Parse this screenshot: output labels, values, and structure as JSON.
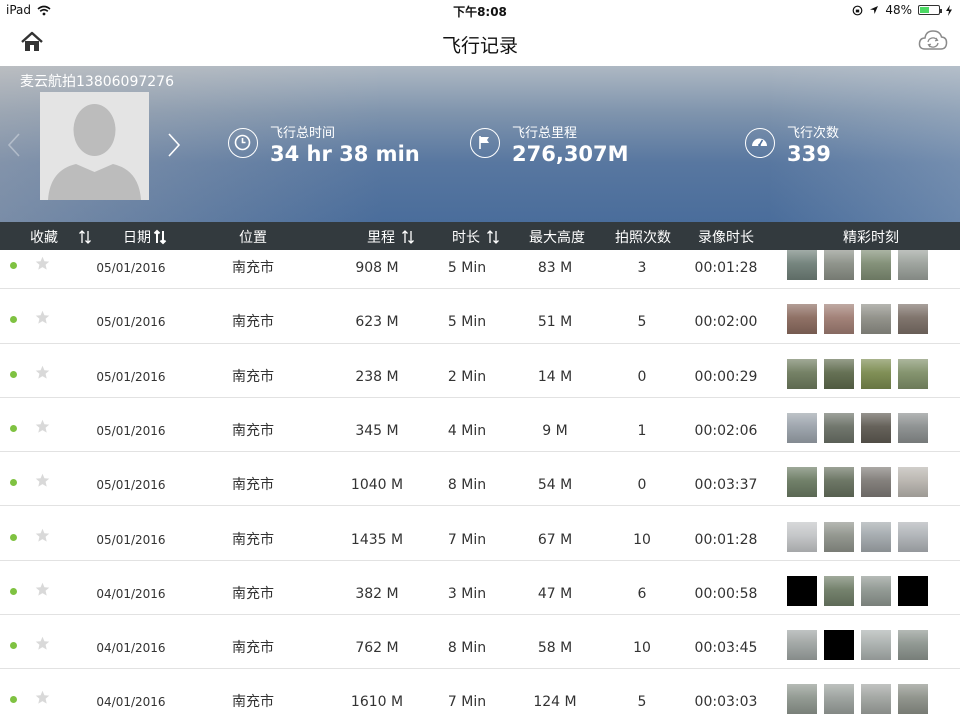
{
  "status_bar": {
    "device": "iPad",
    "time": "下午8:08",
    "battery": "48%",
    "battery_level": 0.48
  },
  "nav": {
    "title": "飞行记录",
    "home_icon": "home-icon",
    "sync_icon": "cloud-sync-icon"
  },
  "profile": {
    "username": "麦云航拍13806097276",
    "stats": [
      {
        "label": "飞行总时间",
        "value": "34 hr 38 min",
        "icon": "clock-icon"
      },
      {
        "label": "飞行总里程",
        "value": "276,307M",
        "icon": "flag-icon"
      },
      {
        "label": "飞行次数",
        "value": "339",
        "icon": "speedometer-icon"
      }
    ]
  },
  "table": {
    "headers": {
      "favorite": "收藏",
      "date": "日期",
      "location": "位置",
      "distance": "里程",
      "duration": "时长",
      "max_height": "最大高度",
      "photos": "拍照次数",
      "video": "录像时长",
      "highlights": "精彩时刻"
    },
    "rows": [
      {
        "date": "05/01/2016",
        "location": "南充市",
        "distance": "908 M",
        "duration": "5 Min",
        "max_height": "83 M",
        "photos": "3",
        "video": "00:01:28",
        "thumbs": [
          "#6f7f78",
          "#8a8f86",
          "#7e8c73",
          "#9aa09a"
        ]
      },
      {
        "date": "05/01/2016",
        "location": "南充市",
        "distance": "623 M",
        "duration": "5 Min",
        "max_height": "51 M",
        "photos": "5",
        "video": "00:02:00",
        "thumbs": [
          "#8a6a5e",
          "#9e7c72",
          "#8e8e86",
          "#7a6e66"
        ]
      },
      {
        "date": "05/01/2016",
        "location": "南充市",
        "distance": "238 M",
        "duration": "2 Min",
        "max_height": "14 M",
        "photos": "0",
        "video": "00:00:29",
        "thumbs": [
          "#6e7b5e",
          "#5e6a4c",
          "#7a8a4e",
          "#7f8f68"
        ]
      },
      {
        "date": "05/01/2016",
        "location": "南充市",
        "distance": "345 M",
        "duration": "4 Min",
        "max_height": "9 M",
        "photos": "1",
        "video": "00:02:06",
        "thumbs": [
          "#9aa2aa",
          "#6a7066",
          "#5e5a52",
          "#8a8e8e"
        ]
      },
      {
        "date": "05/01/2016",
        "location": "南充市",
        "distance": "1040 M",
        "duration": "8 Min",
        "max_height": "54 M",
        "photos": "0",
        "video": "00:03:37",
        "thumbs": [
          "#6a7a62",
          "#66705e",
          "#7e7a76",
          "#b8b4ae"
        ]
      },
      {
        "date": "05/01/2016",
        "location": "南充市",
        "distance": "1435 M",
        "duration": "7 Min",
        "max_height": "67 M",
        "photos": "10",
        "video": "00:01:28",
        "thumbs": [
          "#c2c4c6",
          "#8e928a",
          "#a2a8ac",
          "#aeb2b6"
        ]
      },
      {
        "date": "04/01/2016",
        "location": "南充市",
        "distance": "382 M",
        "duration": "3 Min",
        "max_height": "47 M",
        "photos": "6",
        "video": "00:00:58",
        "thumbs": [
          "#000000",
          "#6e7c66",
          "#8e9690",
          "#000000"
        ]
      },
      {
        "date": "04/01/2016",
        "location": "南充市",
        "distance": "762 M",
        "duration": "8 Min",
        "max_height": "58 M",
        "photos": "10",
        "video": "00:03:45",
        "thumbs": [
          "#9ea4a2",
          "#000000",
          "#aab0ae",
          "#8c948e"
        ]
      },
      {
        "date": "04/01/2016",
        "location": "南充市",
        "distance": "1610 M",
        "duration": "7 Min",
        "max_height": "124 M",
        "photos": "5",
        "video": "00:03:03",
        "thumbs": [
          "#8e968e",
          "#9aa09c",
          "#a0a4a0",
          "#8c9088"
        ]
      }
    ]
  }
}
